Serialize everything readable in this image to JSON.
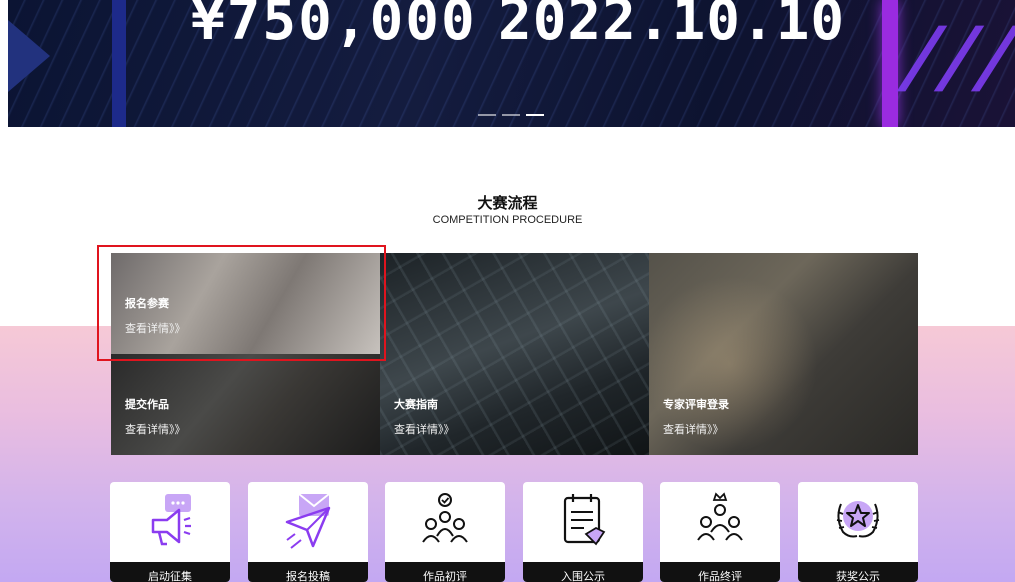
{
  "banner": {
    "prize": "¥750,000",
    "date": "2022.10.10",
    "slides": 3,
    "active_slide": 3
  },
  "section": {
    "title": "大赛流程",
    "subtitle": "COMPETITION PROCEDURE"
  },
  "procedure": [
    {
      "title": "报名参赛",
      "link": "查看详情》》"
    },
    {
      "title": "提交作品",
      "link": "查看详情》》"
    },
    {
      "title": "大赛指南",
      "link": "查看详情》》"
    },
    {
      "title": "专家评审登录",
      "link": "查看详情》》"
    }
  ],
  "stages": [
    {
      "label": "启动征集",
      "icon": "megaphone-icon"
    },
    {
      "label": "报名投稿",
      "icon": "paper-plane-icon"
    },
    {
      "label": "作品初评",
      "icon": "group-review-icon"
    },
    {
      "label": "入围公示",
      "icon": "calendar-list-icon"
    },
    {
      "label": "作品终评",
      "icon": "crowned-group-icon"
    },
    {
      "label": "获奖公示",
      "icon": "star-laurel-icon"
    }
  ],
  "colors": {
    "highlight_border": "#e0141e",
    "accent_purple": "#8b3cf0",
    "banner_bg": "#0b1433"
  }
}
